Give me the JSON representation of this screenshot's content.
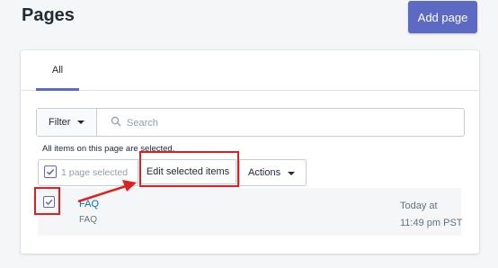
{
  "header": {
    "title": "Pages",
    "add_button_label": "Add page"
  },
  "tabs": [
    {
      "label": "All",
      "active": true
    }
  ],
  "filter": {
    "button_label": "Filter",
    "search_placeholder": "Search",
    "search_value": ""
  },
  "bulk": {
    "note": "All items on this page are selected.",
    "selected_label": "1 page selected",
    "edit_label": "Edit selected items",
    "actions_label": "Actions"
  },
  "rows": [
    {
      "title": "FAQ",
      "subtitle": "FAQ",
      "updated": "Today at 11:49 pm PST",
      "checked": true
    }
  ],
  "colors": {
    "accent": "#5c6ac4",
    "link": "#006fbb",
    "annotation": "#e02020",
    "background": "#f4f6f8"
  },
  "icons": [
    "search-icon",
    "chevron-down-icon",
    "checkmark-icon",
    "annotation-arrow"
  ]
}
